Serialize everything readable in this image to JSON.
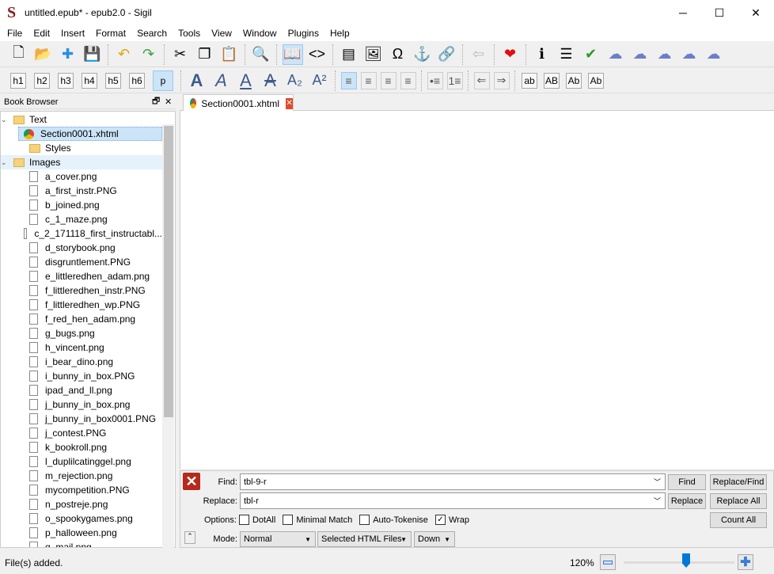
{
  "window": {
    "title": "untitled.epub* - epub2.0 - Sigil",
    "logo": "S",
    "minimize": "─",
    "maximize": "☐",
    "close": "✕"
  },
  "menu": [
    "File",
    "Edit",
    "Insert",
    "Format",
    "Search",
    "Tools",
    "View",
    "Window",
    "Plugins",
    "Help"
  ],
  "toolbar1": [
    {
      "name": "new-file-icon",
      "glyph": "🗋"
    },
    {
      "name": "open-folder-icon",
      "glyph": "📂"
    },
    {
      "name": "add-icon",
      "glyph": "✚"
    },
    {
      "name": "save-icon",
      "glyph": "💾"
    },
    {
      "sep": true
    },
    {
      "name": "undo-icon",
      "glyph": "↶"
    },
    {
      "name": "redo-icon",
      "glyph": "↷"
    },
    {
      "sep": true
    },
    {
      "name": "cut-icon",
      "glyph": "✂"
    },
    {
      "name": "copy-icon",
      "glyph": "❐"
    },
    {
      "name": "paste-icon",
      "glyph": "📋"
    },
    {
      "sep": true
    },
    {
      "name": "find-icon",
      "glyph": "🔍"
    },
    {
      "sep": true
    },
    {
      "name": "book-view-icon",
      "glyph": "📖",
      "active": true
    },
    {
      "name": "code-view-icon",
      "glyph": "<>"
    },
    {
      "sep": true
    },
    {
      "name": "split-icon",
      "glyph": "▤"
    },
    {
      "name": "insert-image-icon",
      "glyph": "🖼"
    },
    {
      "name": "special-char-icon",
      "glyph": "Ω"
    },
    {
      "name": "anchor-icon",
      "glyph": "⚓"
    },
    {
      "name": "link-icon",
      "glyph": "🔗"
    },
    {
      "sep": true
    },
    {
      "name": "back-arrow-icon",
      "glyph": "⇦"
    },
    {
      "sep": true
    },
    {
      "name": "heart-icon",
      "glyph": "❤"
    },
    {
      "sep": true
    },
    {
      "name": "metadata-icon",
      "glyph": "ℹ"
    },
    {
      "name": "toc-icon",
      "glyph": "☰"
    },
    {
      "name": "spellcheck-icon",
      "glyph": "✔"
    },
    {
      "name": "plugin-1-icon",
      "glyph": "☁"
    },
    {
      "name": "plugin-2-icon",
      "glyph": "☁"
    },
    {
      "name": "plugin-3-icon",
      "glyph": "☁"
    },
    {
      "name": "plugin-4-icon",
      "glyph": "☁"
    },
    {
      "name": "plugin-5-icon",
      "glyph": "☁"
    }
  ],
  "headings": [
    "h1",
    "h2",
    "h3",
    "h4",
    "h5",
    "h6",
    "p"
  ],
  "format": [
    {
      "name": "bold-icon",
      "glyph": "A"
    },
    {
      "name": "italic-icon",
      "glyph": "A"
    },
    {
      "name": "underline-icon",
      "glyph": "A"
    },
    {
      "name": "strikethrough-icon",
      "glyph": "A"
    },
    {
      "name": "subscript-icon",
      "glyph": "A₂"
    },
    {
      "name": "superscript-icon",
      "glyph": "A²"
    }
  ],
  "align": [
    {
      "name": "align-left-icon",
      "glyph": "≡",
      "active": true
    },
    {
      "name": "align-center-icon",
      "glyph": "≡"
    },
    {
      "name": "align-right-icon",
      "glyph": "≡"
    },
    {
      "name": "justify-icon",
      "glyph": "≡"
    }
  ],
  "lists": [
    {
      "name": "bullet-list-icon",
      "glyph": "•≡"
    },
    {
      "name": "numbered-list-icon",
      "glyph": "1≡"
    }
  ],
  "indent": [
    {
      "name": "outdent-icon",
      "glyph": "⇐"
    },
    {
      "name": "indent-icon",
      "glyph": "⇒"
    }
  ],
  "case": [
    "ab",
    "AB",
    "Ab",
    "Ab"
  ],
  "book_browser": {
    "title": "Book Browser",
    "float": "🗗",
    "close": "✕",
    "folders": {
      "text": "Text",
      "styles": "Styles",
      "images": "Images"
    },
    "text_files": [
      "Section0001.xhtml"
    ],
    "images": [
      "a_cover.png",
      "a_first_instr.PNG",
      "b_joined.png",
      "c_1_maze.png",
      "c_2_171118_first_instructabl...",
      "d_storybook.png",
      "disgruntlement.PNG",
      "e_littleredhen_adam.png",
      "f_littleredhen_instr.PNG",
      "f_littleredhen_wp.PNG",
      "f_red_hen_adam.png",
      "g_bugs.png",
      "h_vincent.png",
      "i_bear_dino.png",
      "i_bunny_in_box.PNG",
      "ipad_and_ll.png",
      "j_bunny_in_box.png",
      "j_bunny_in_box0001.PNG",
      "j_contest.PNG",
      "k_bookroll.png",
      "l_duplilcatinggel.png",
      "m_rejection.png",
      "mycompetition.PNG",
      "n_postreje.png",
      "o_spookygames.png",
      "p_halloween.png",
      "q_mail.png"
    ]
  },
  "tab": {
    "label": "Section0001.xhtml",
    "close": "✕"
  },
  "find": {
    "find_label": "Find:",
    "find_value": "tbl-9-r",
    "replace_label": "Replace:",
    "replace_value": "tbl-r",
    "options_label": "Options:",
    "options": [
      {
        "label": "DotAll",
        "checked": false
      },
      {
        "label": "Minimal Match",
        "checked": false
      },
      {
        "label": "Auto-Tokenise",
        "checked": false
      },
      {
        "label": "Wrap",
        "checked": true
      }
    ],
    "mode_label": "Mode:",
    "mode": "Normal",
    "scope": "Selected HTML Files",
    "direction": "Down",
    "buttons": {
      "find": "Find",
      "replace_find": "Replace/Find",
      "replace": "Replace",
      "replace_all": "Replace All",
      "count_all": "Count All"
    }
  },
  "status": {
    "message": "File(s) added.",
    "zoom": "120%",
    "zoom_percent": 120
  },
  "colors": {
    "accent": "#0078d7",
    "active_bg": "#cce4f7"
  }
}
